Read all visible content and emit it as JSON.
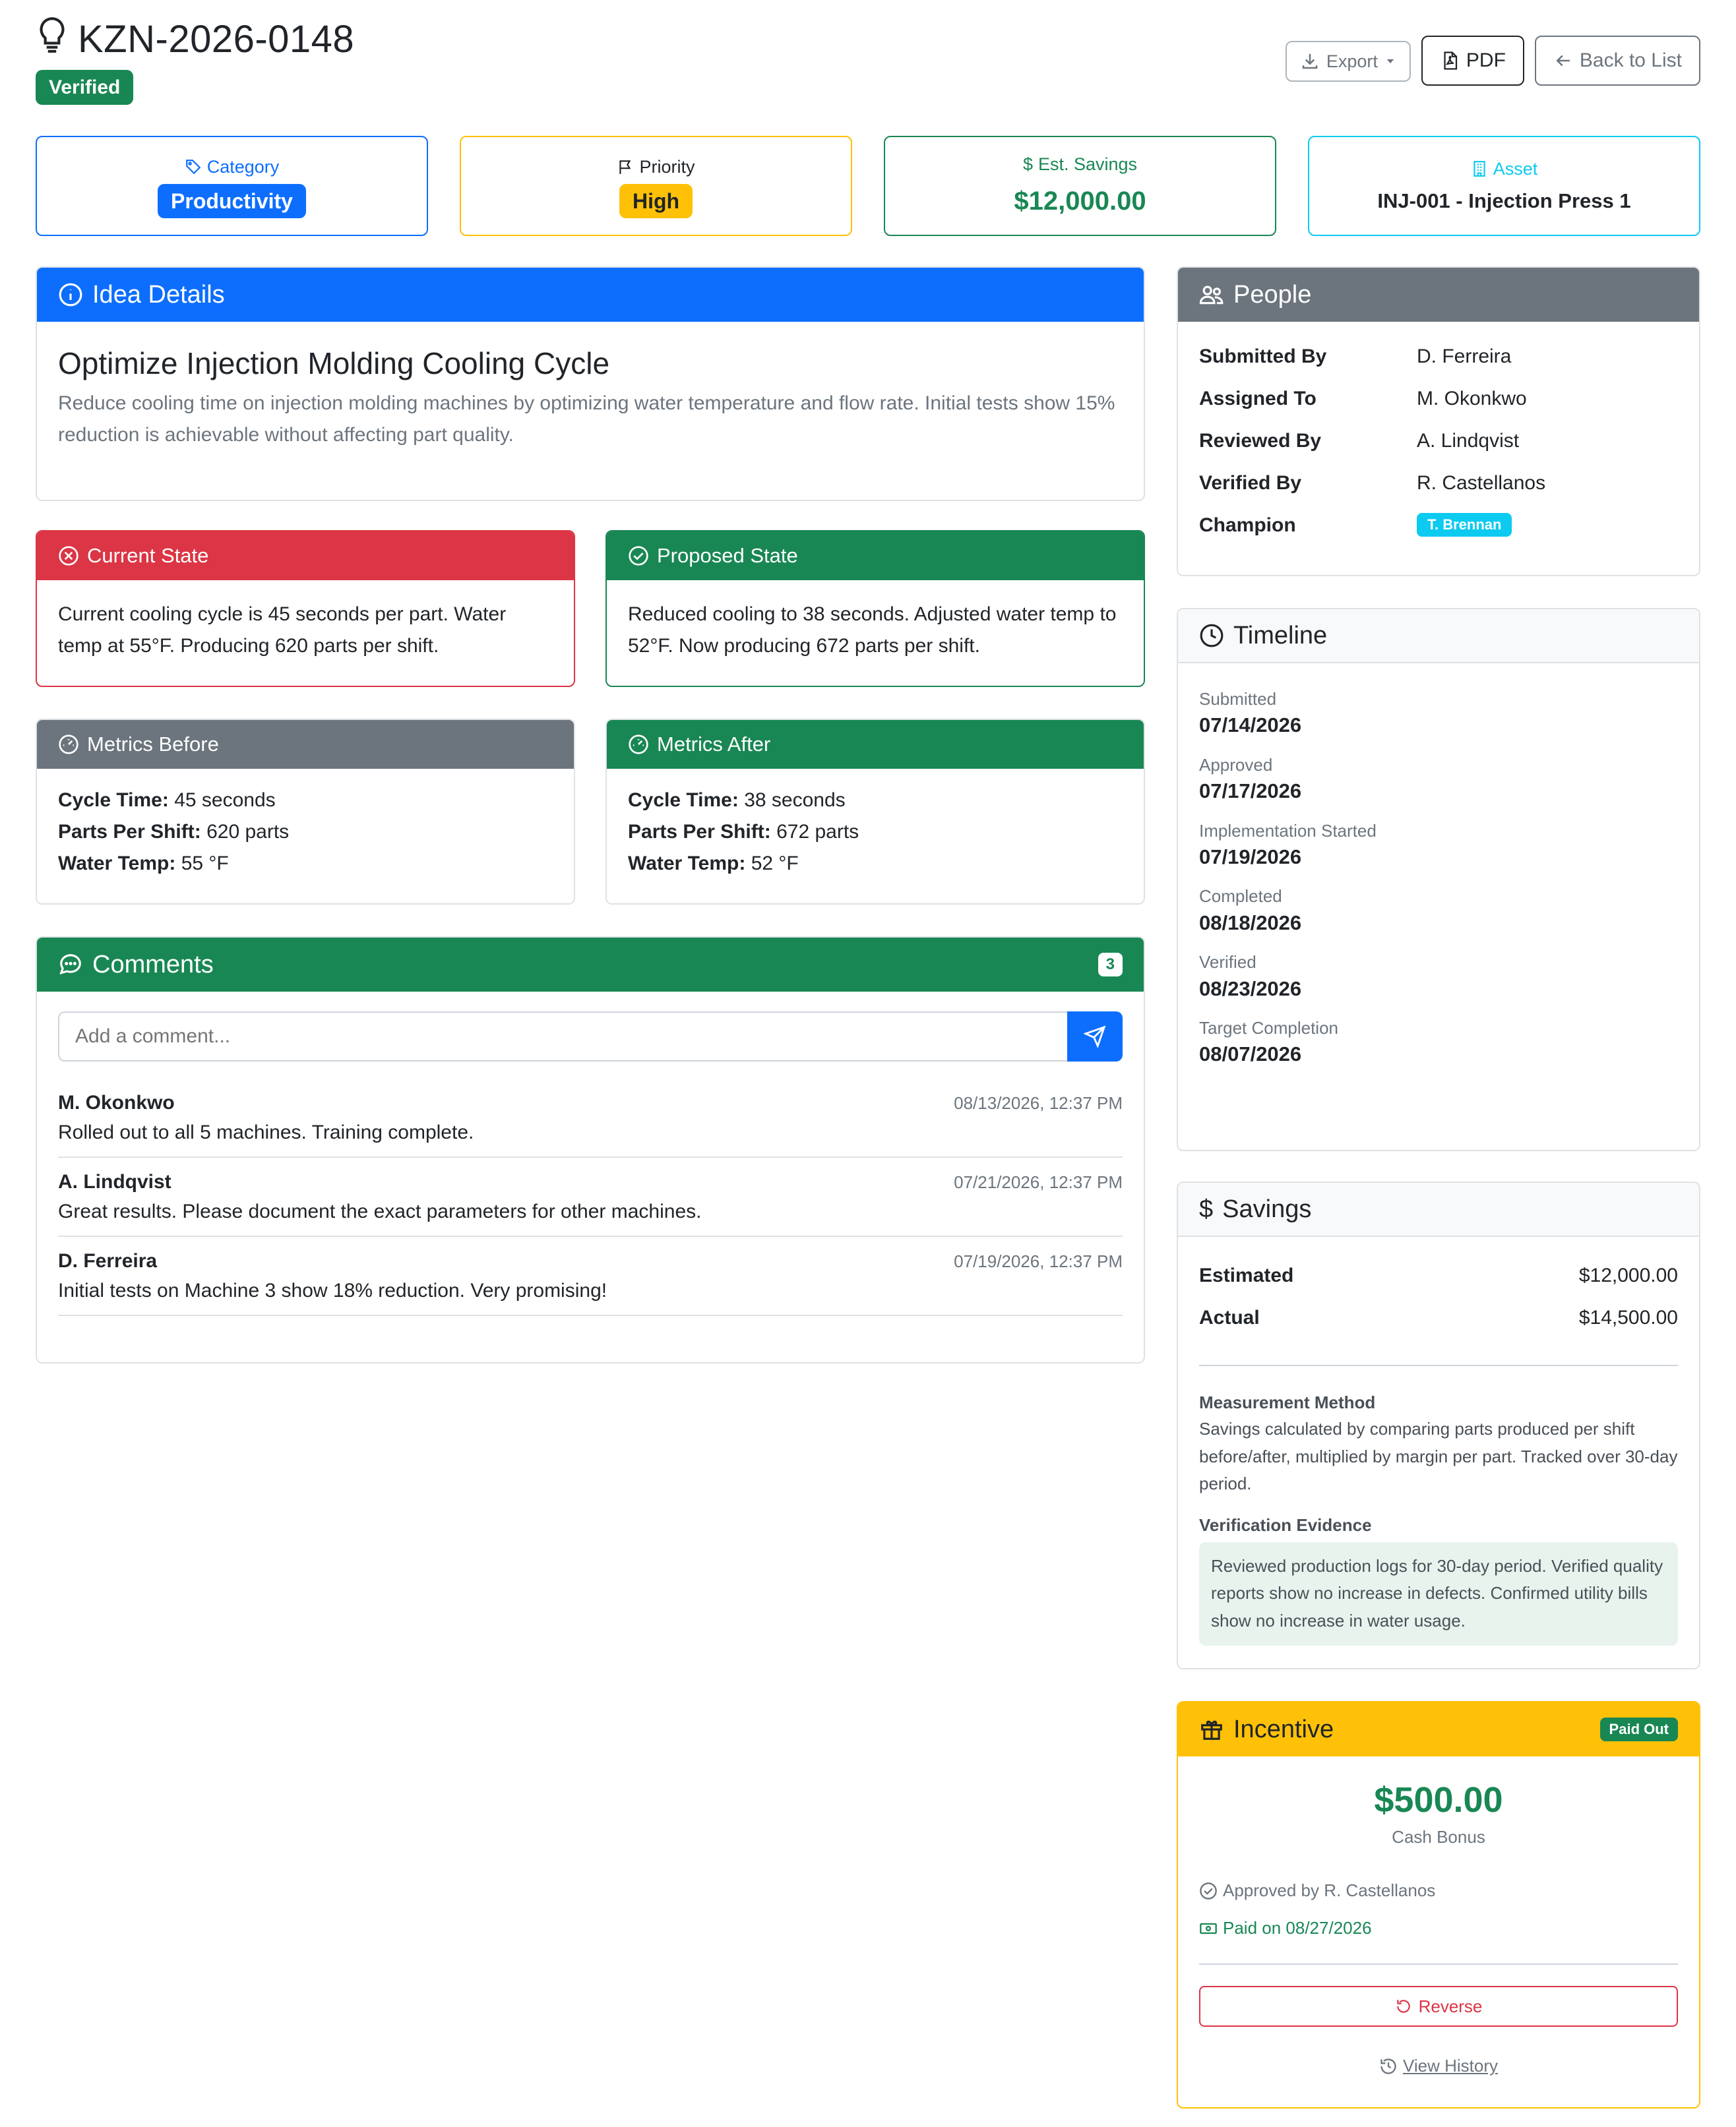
{
  "header": {
    "id": "KZN-2026-0148",
    "status": "Verified",
    "export_label": "Export",
    "pdf_label": "PDF",
    "back_label": "Back to List"
  },
  "kpis": {
    "category_label": "Category",
    "category_value": "Productivity",
    "priority_label": "Priority",
    "priority_value": "High",
    "savings_label": "Est. Savings",
    "savings_value": "$12,000.00",
    "asset_label": "Asset",
    "asset_value": "INJ-001 - Injection Press 1"
  },
  "idea": {
    "header": "Idea Details",
    "title": "Optimize Injection Molding Cooling Cycle",
    "description": "Reduce cooling time on injection molding machines by optimizing water temperature and flow rate. Initial tests show 15% reduction is achievable without affecting part quality."
  },
  "current_state": {
    "header": "Current State",
    "text": "Current cooling cycle is 45 seconds per part. Water temp at 55°F. Producing 620 parts per shift."
  },
  "proposed_state": {
    "header": "Proposed State",
    "text": "Reduced cooling to 38 seconds. Adjusted water temp to 52°F. Now producing 672 parts per shift."
  },
  "metrics_before": {
    "header": "Metrics Before",
    "items": [
      {
        "key": "Cycle Time:",
        "value": "45 seconds"
      },
      {
        "key": "Parts Per Shift:",
        "value": "620 parts"
      },
      {
        "key": "Water Temp:",
        "value": "55 °F"
      }
    ]
  },
  "metrics_after": {
    "header": "Metrics After",
    "items": [
      {
        "key": "Cycle Time:",
        "value": "38 seconds"
      },
      {
        "key": "Parts Per Shift:",
        "value": "672 parts"
      },
      {
        "key": "Water Temp:",
        "value": "52 °F"
      }
    ]
  },
  "comments": {
    "header": "Comments",
    "count": "3",
    "placeholder": "Add a comment...",
    "items": [
      {
        "author": "M. Okonkwo",
        "date": "08/13/2026, 12:37 PM",
        "text": "Rolled out to all 5 machines. Training complete."
      },
      {
        "author": "A. Lindqvist",
        "date": "07/21/2026, 12:37 PM",
        "text": "Great results. Please document the exact parameters for other machines."
      },
      {
        "author": "D. Ferreira",
        "date": "07/19/2026, 12:37 PM",
        "text": "Initial tests on Machine 3 show 18% reduction. Very promising!"
      }
    ]
  },
  "people": {
    "header": "People",
    "rows": [
      {
        "key": "Submitted By",
        "value": "D. Ferreira"
      },
      {
        "key": "Assigned To",
        "value": "M. Okonkwo"
      },
      {
        "key": "Reviewed By",
        "value": "A. Lindqvist"
      },
      {
        "key": "Verified By",
        "value": "R. Castellanos"
      }
    ],
    "champion_label": "Champion",
    "champion_value": "T. Brennan"
  },
  "timeline": {
    "header": "Timeline",
    "items": [
      {
        "label": "Submitted",
        "date": "07/14/2026"
      },
      {
        "label": "Approved",
        "date": "07/17/2026"
      },
      {
        "label": "Implementation Started",
        "date": "07/19/2026"
      },
      {
        "label": "Completed",
        "date": "08/18/2026"
      },
      {
        "label": "Verified",
        "date": "08/23/2026"
      },
      {
        "label": "Target Completion",
        "date": "08/07/2026"
      }
    ]
  },
  "savings": {
    "header": "Savings",
    "estimated_label": "Estimated",
    "estimated_value": "$12,000.00",
    "actual_label": "Actual",
    "actual_value": "$14,500.00",
    "method_label": "Measurement Method",
    "method_text": "Savings calculated by comparing parts produced per shift before/after, multiplied by margin per part. Tracked over 30-day period.",
    "evidence_label": "Verification Evidence",
    "evidence_text": "Reviewed production logs for 30-day period. Verified quality reports show no increase in defects. Confirmed utility bills show no increase in water usage."
  },
  "incentive": {
    "header": "Incentive",
    "status": "Paid Out",
    "amount": "$500.00",
    "type": "Cash Bonus",
    "approved_by": "Approved by R. Castellanos",
    "paid_on": "Paid on 08/27/2026",
    "reverse_label": "Reverse",
    "history_label": "View History"
  },
  "colors": {
    "primary": "#0d6efd",
    "success": "#198754",
    "danger": "#dc3545",
    "warning": "#ffc107",
    "info": "#0dcaf0",
    "secondary": "#6c757d"
  }
}
